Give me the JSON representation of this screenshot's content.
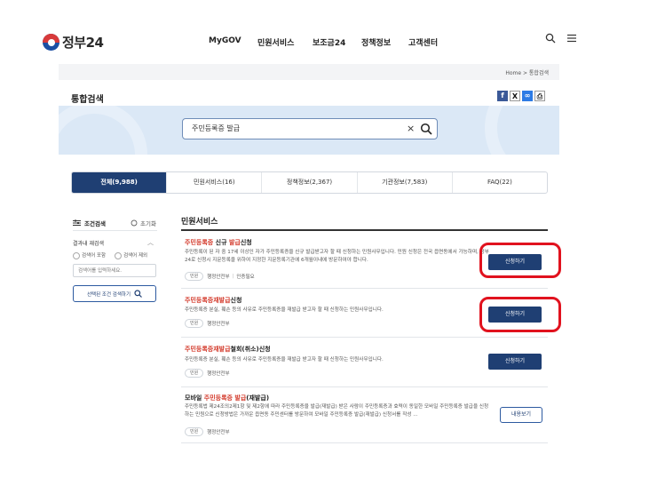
{
  "header": {
    "logo_text": "정부24",
    "nav": [
      "MyGOV",
      "민원서비스",
      "보조금24",
      "정책정보",
      "고객센터"
    ]
  },
  "breadcrumb": "Home > 통합검색",
  "page_title": "통합검색",
  "search": {
    "value": "주민등록증 발급",
    "clear_label": "×"
  },
  "tabs": [
    "전체(9,988)",
    "민원서비스(16)",
    "정책정보(2,367)",
    "기관정보(7,583)",
    "FAQ(22)"
  ],
  "filter": {
    "title": "조건검색",
    "reset_label": "초기화",
    "within_label": "결과내 재검색",
    "include_label": "검색어 포함",
    "exclude_label": "검색어 제외",
    "within_placeholder": "검색어를 입력하세요.",
    "search_selected_label": "선택된 조건 검색하기"
  },
  "section_title": "민원서비스",
  "results": [
    {
      "title_hl1": "주민등록증",
      "title_mid": " 신규 ",
      "title_hl2": "발급",
      "title_end": "신청",
      "desc": "주민등록이 된 자 중 17세 이상인 자가 주민등록증을 신규 발급받고자 할 때 신청하는 민원사무입니다. 민원 신청은 전국 읍면동에서 가능하며, 정부24로 신청시 지문등록을 위하여 지정한 지문등록기관에 6개월이내에 방문하여야 합니다.",
      "tag": "민원",
      "org1": "행정안전부",
      "org2": "인증필요",
      "button": "신청하기"
    },
    {
      "title_hl1": "주민등록증재발급",
      "title_end": "신청",
      "desc": "주민등록증 분실, 훼손 등의 사유로 주민등록증을 재발급 받고자 할 때 신청하는 민원사무입니다.",
      "tag": "민원",
      "org1": "행정안전부",
      "button": "신청하기"
    },
    {
      "title_hl1": "주민등록증재발급",
      "title_end": "철회(취소)신청",
      "desc": "주민등록증 분실, 훼손 등의 사유로 주민등록증을 재발급 받고자 할 때 신청하는 민원사무입니다.",
      "tag": "민원",
      "org1": "행정안전부",
      "button": "신청하기"
    },
    {
      "title_pre": "모바일 ",
      "title_hl1": "주민등록증 발급",
      "title_end": "(재발급)",
      "desc": "주민등록법 제24조의2제1항 및 제2항에 따라 주민등록증을 발급(재발급) 받은 사람이 주민등록증과 효력이 동일한 모바일 주민등록증 발급을 신청하는 민원으로 신청방법은 가까운 읍면동 주민센터를 방문하여 모바일 주민등록증 발급(재발급) 신청서를 작성 ...",
      "tag": "민원",
      "org1": "행정안전부",
      "button": "내용보기"
    }
  ]
}
